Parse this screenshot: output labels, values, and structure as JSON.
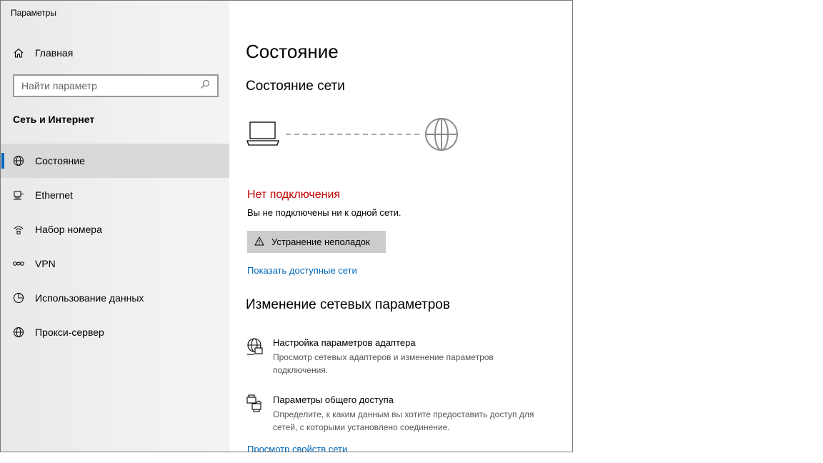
{
  "window": {
    "title": "Параметры"
  },
  "sidebar": {
    "home_label": "Главная",
    "search_placeholder": "Найти параметр",
    "section_title": "Сеть и Интернет",
    "items": [
      {
        "label": "Состояние",
        "icon": "globe-icon",
        "active": true
      },
      {
        "label": "Ethernet",
        "icon": "ethernet-icon",
        "active": false
      },
      {
        "label": "Набор номера",
        "icon": "dialup-icon",
        "active": false
      },
      {
        "label": "VPN",
        "icon": "vpn-icon",
        "active": false
      },
      {
        "label": "Использование данных",
        "icon": "data-usage-icon",
        "active": false
      },
      {
        "label": "Прокси-сервер",
        "icon": "globe-icon",
        "active": false
      }
    ]
  },
  "main": {
    "page_title": "Состояние",
    "network_status_heading": "Состояние сети",
    "status_title": "Нет подключения",
    "status_desc": "Вы не подключены ни к одной сети.",
    "troubleshoot_label": "Устранение неполадок",
    "show_networks_link": "Показать доступные сети",
    "change_heading": "Изменение сетевых параметров",
    "settings": [
      {
        "title": "Настройка параметров адаптера",
        "desc": "Просмотр сетевых адаптеров и изменение параметров подключения.",
        "icon": "adapter-icon"
      },
      {
        "title": "Параметры общего доступа",
        "desc": "Определите, к каким данным вы хотите предоставить доступ для сетей, с которыми установлено соединение.",
        "icon": "sharing-icon"
      }
    ],
    "properties_link": "Просмотр свойств сети"
  },
  "colors": {
    "accent": "#0067c0",
    "link": "#0067b8",
    "error": "#c00000"
  }
}
